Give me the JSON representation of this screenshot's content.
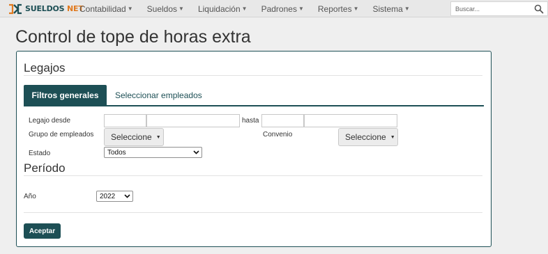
{
  "navbar": {
    "logo_text_main": "SUELDOS",
    "logo_text_accent": "NET",
    "menu": [
      {
        "label": "Contabilidad"
      },
      {
        "label": "Sueldos"
      },
      {
        "label": "Liquidación"
      },
      {
        "label": "Padrones"
      },
      {
        "label": "Reportes"
      },
      {
        "label": "Sistema"
      }
    ],
    "search_placeholder": "Buscar...",
    "search_icon": "search-icon"
  },
  "page": {
    "title": "Control de tope de horas extra"
  },
  "legajos": {
    "title": "Legajos",
    "tabs": [
      {
        "label": "Filtros generales",
        "active": true
      },
      {
        "label": "Seleccionar empleados",
        "active": false
      }
    ],
    "legajo_desde_label": "Legajo desde",
    "hasta_label": "hasta",
    "grupo_label": "Grupo de empleados",
    "grupo_button": "Seleccione",
    "convenio_label": "Convenio",
    "convenio_button": "Seleccione",
    "estado_label": "Estado",
    "estado_value": "Todos"
  },
  "periodo": {
    "title": "Período",
    "anio_label": "Año",
    "anio_value": "2022"
  },
  "actions": {
    "aceptar_label": "Aceptar"
  },
  "colors": {
    "primary": "#1d4f55",
    "accent": "#e07a1f",
    "navbar_bg": "#e8e8e8",
    "page_bg": "#efefef"
  }
}
